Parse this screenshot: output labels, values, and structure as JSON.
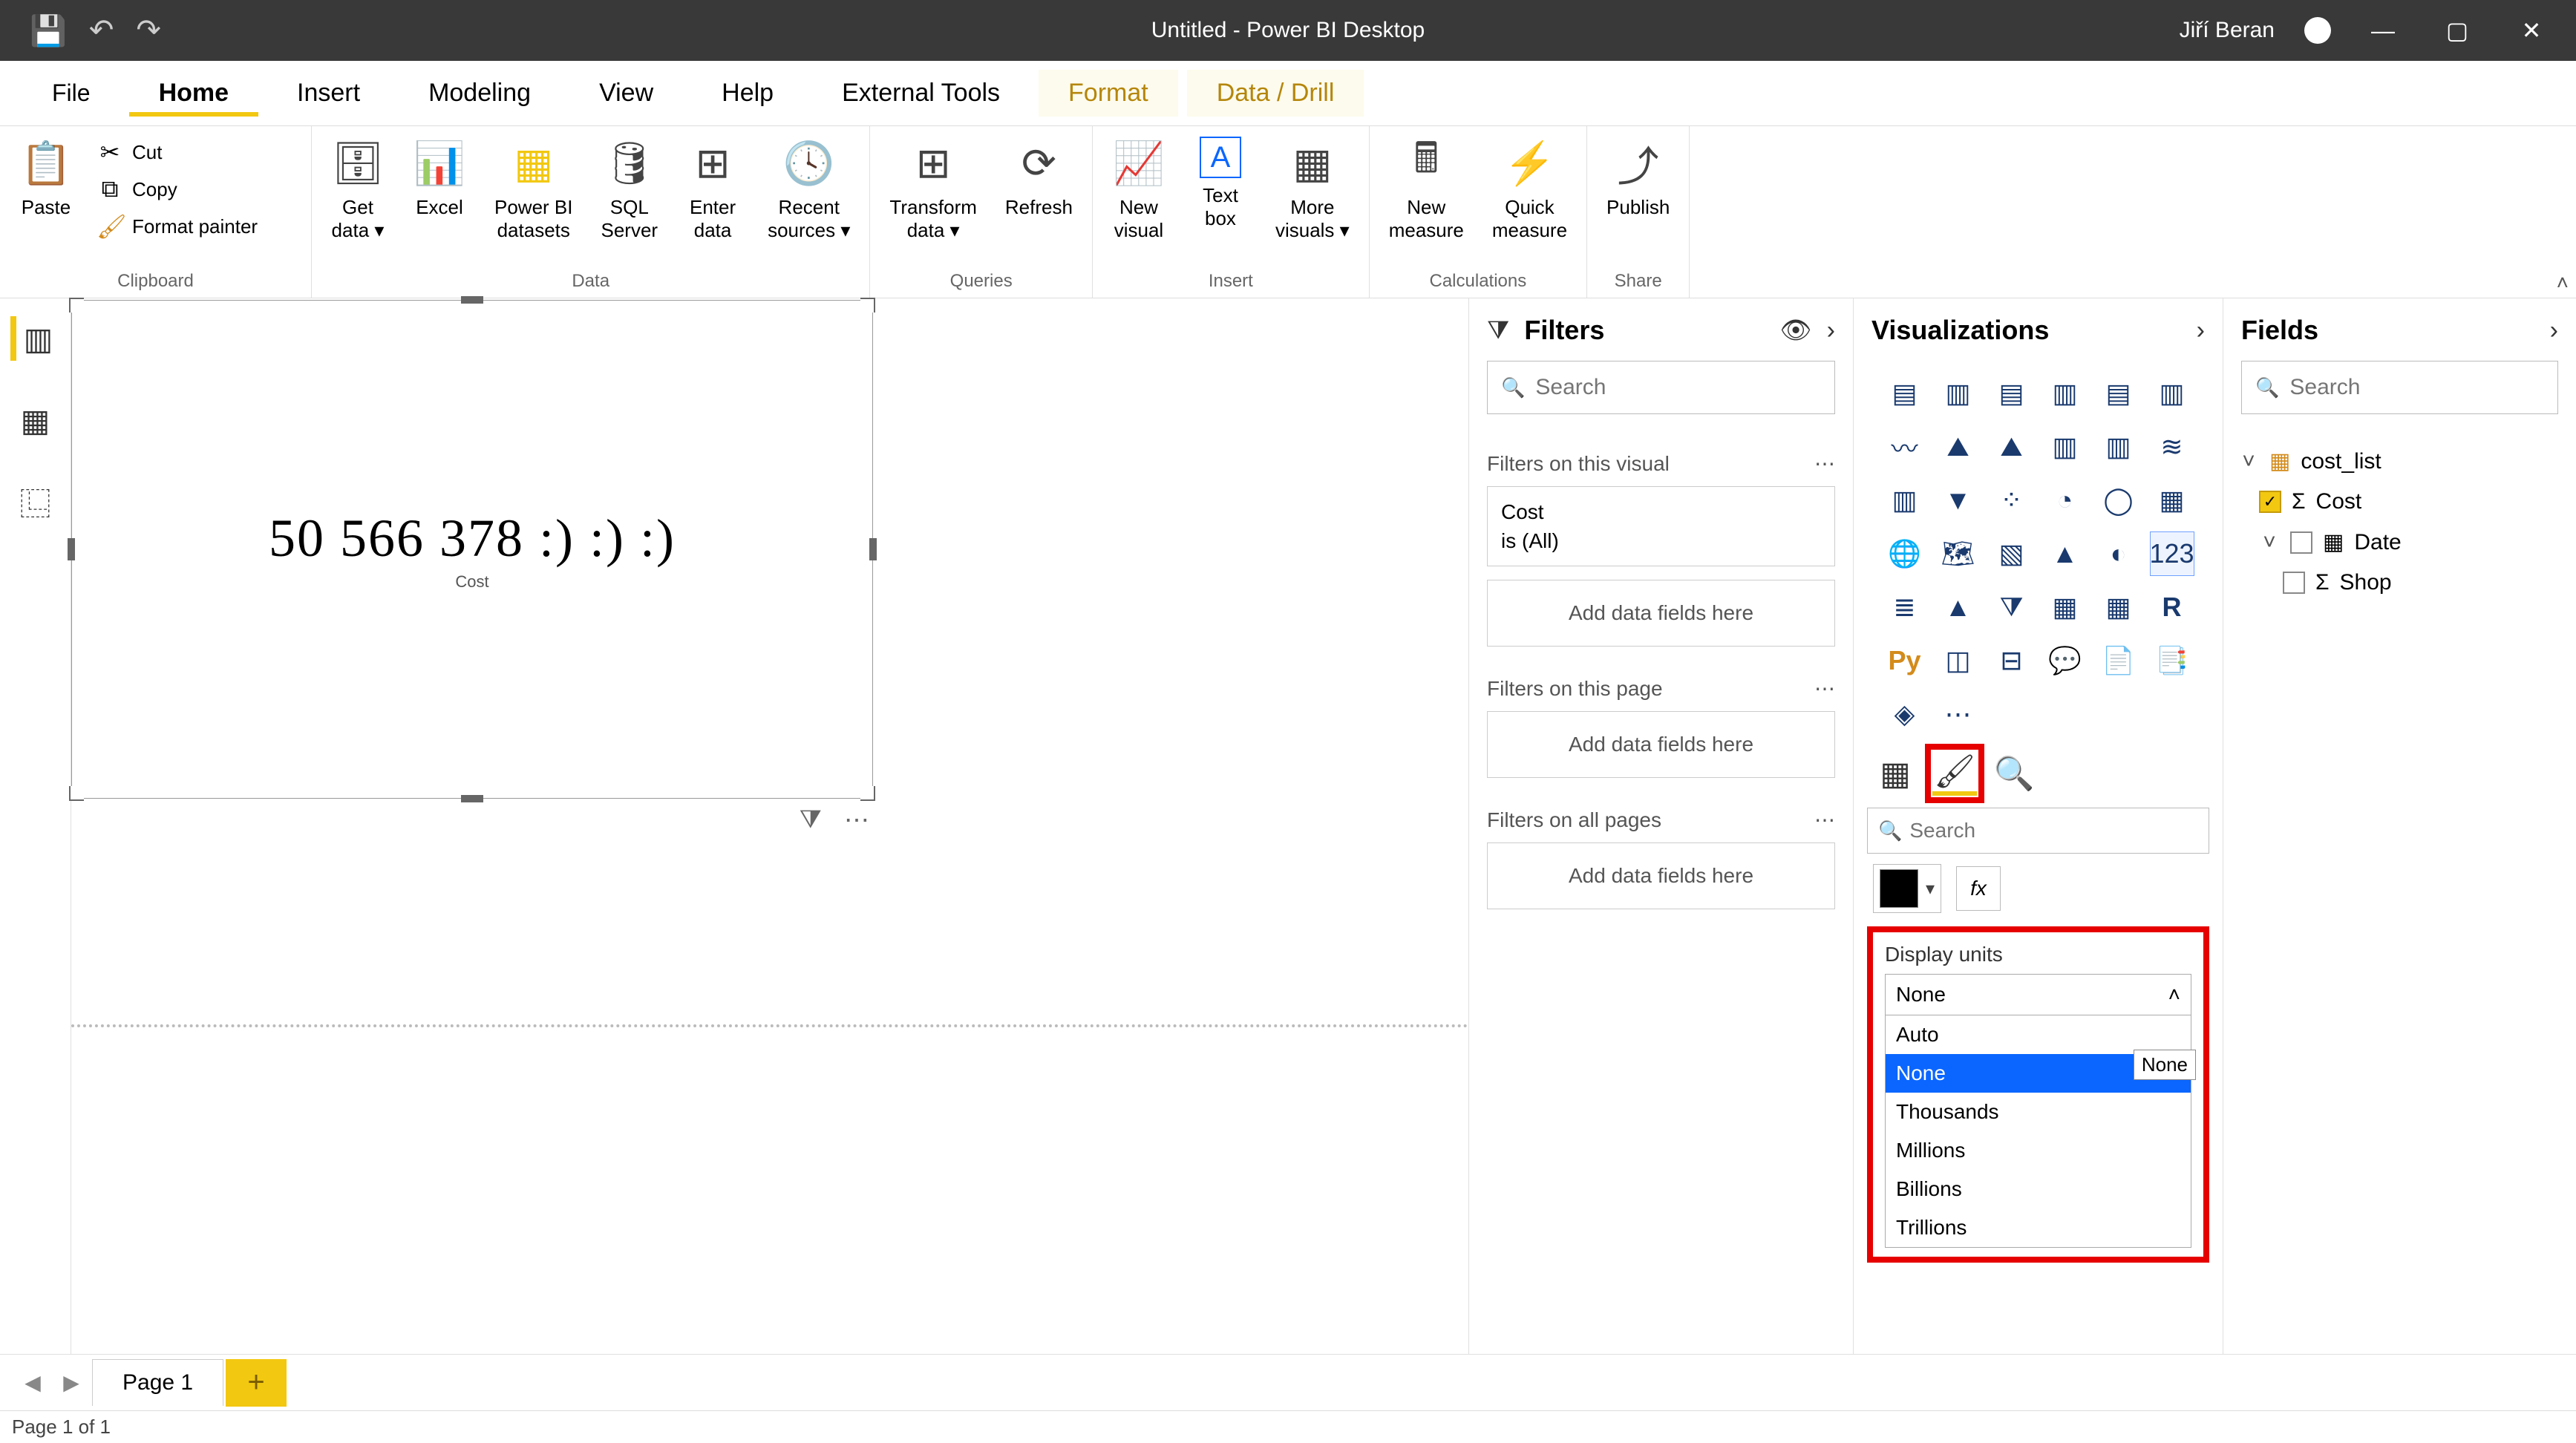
{
  "titlebar": {
    "title": "Untitled - Power BI Desktop",
    "user": "Jiří Beran"
  },
  "ribbon_tabs": {
    "file": "File",
    "home": "Home",
    "insert": "Insert",
    "modeling": "Modeling",
    "view": "View",
    "help": "Help",
    "external": "External Tools",
    "format": "Format",
    "datadrill": "Data / Drill"
  },
  "ribbon": {
    "paste": "Paste",
    "cut": "Cut",
    "copy": "Copy",
    "format_painter": "Format painter",
    "clipboard_group": "Clipboard",
    "get_data": "Get\ndata",
    "excel": "Excel",
    "pbi_datasets": "Power BI\ndatasets",
    "sql_server": "SQL\nServer",
    "enter_data": "Enter\ndata",
    "recent_sources": "Recent\nsources",
    "data_group": "Data",
    "transform_data": "Transform\ndata",
    "refresh": "Refresh",
    "queries_group": "Queries",
    "new_visual": "New\nvisual",
    "text_box": "Text\nbox",
    "more_visuals": "More\nvisuals",
    "insert_group": "Insert",
    "new_measure": "New\nmeasure",
    "quick_measure": "Quick\nmeasure",
    "calculations_group": "Calculations",
    "publish": "Publish",
    "share_group": "Share"
  },
  "visual": {
    "value": "50 566 378 :) :) :)",
    "label": "Cost"
  },
  "filters": {
    "header": "Filters",
    "search_placeholder": "Search",
    "on_visual": "Filters on this visual",
    "card_field": "Cost",
    "card_cond": "is (All)",
    "drop_hint": "Add data fields here",
    "on_page": "Filters on this page",
    "on_all": "Filters on all pages"
  },
  "viz": {
    "header": "Visualizations",
    "search_placeholder": "Search",
    "display_units_label": "Display units",
    "du_selected": "None",
    "du_options": [
      "Auto",
      "None",
      "Thousands",
      "Millions",
      "Billions",
      "Trillions"
    ],
    "du_tooltip": "None",
    "fx": "fx"
  },
  "fields": {
    "header": "Fields",
    "search_placeholder": "Search",
    "table": "cost_list",
    "cols": {
      "cost": "Cost",
      "date": "Date",
      "shop": "Shop"
    }
  },
  "page_tabs": {
    "page1": "Page 1"
  },
  "status": {
    "page": "Page 1 of 1"
  }
}
